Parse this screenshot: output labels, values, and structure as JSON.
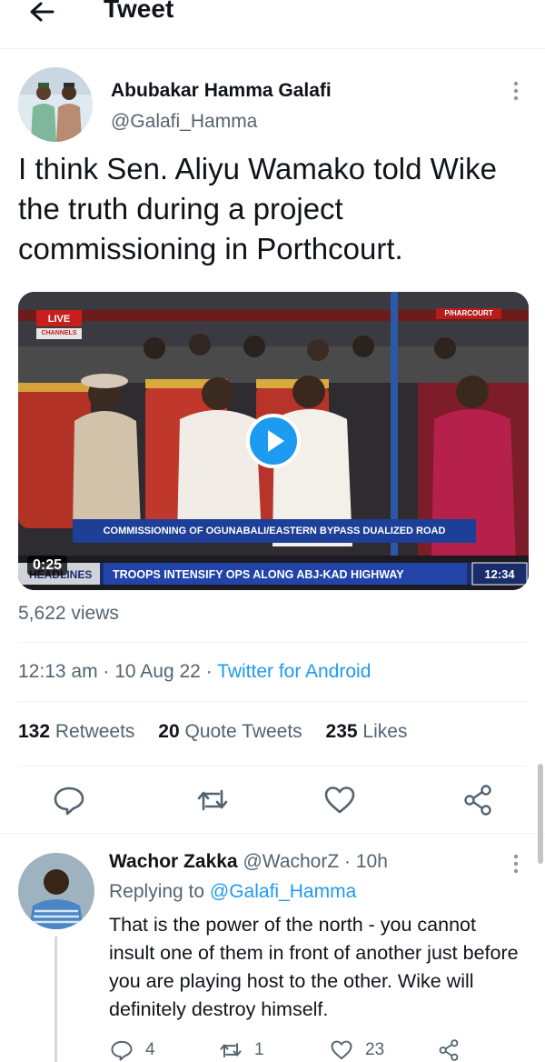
{
  "header": {
    "title": "Tweet"
  },
  "tweet": {
    "author_name": "Abubakar Hamma Galafi",
    "author_handle": "@Galafi_Hamma",
    "text": "I think Sen. Aliyu Wamako told Wike the truth during a project commissioning in Porthcourt.",
    "media": {
      "live_badge": "LIVE",
      "channel": "CHANNELS",
      "location_tag": "P/HARCOURT",
      "caption": "COMMISSIONING OF OGUNABALI/EASTERN BYPASS DUALIZED ROAD",
      "ticker_label": "HEADLINES",
      "ticker_text": "TROOPS INTENSIFY OPS ALONG ABJ-KAD HIGHWAY",
      "clock": "12:34",
      "duration": "0:25"
    },
    "views": "5,622 views",
    "time": "12:13 am",
    "date": "10 Aug 22",
    "separator": "·",
    "source": "Twitter for Android",
    "stats": {
      "retweets_count": "132",
      "retweets_label": "Retweets",
      "quotes_count": "20",
      "quotes_label": "Quote Tweets",
      "likes_count": "235",
      "likes_label": "Likes"
    },
    "actions": [
      "reply-icon",
      "retweet-icon",
      "like-icon",
      "share-icon"
    ]
  },
  "reply": {
    "author_name": "Wachor Zakka",
    "author_handle": "@WachorZ",
    "separator": "·",
    "time": "10h",
    "replying_prefix": "Replying to",
    "replying_handle": "@Galafi_Hamma",
    "text": "That is the power of the north - you cannot insult one of them in front of another just before you are playing host to the other. Wike will definitely destroy himself.",
    "reply_count": "4",
    "retweet_count": "1",
    "like_count": "23"
  },
  "colors": {
    "link": "#1d9bf0",
    "secondary_text": "#536471",
    "primary_text": "#0f1419"
  }
}
